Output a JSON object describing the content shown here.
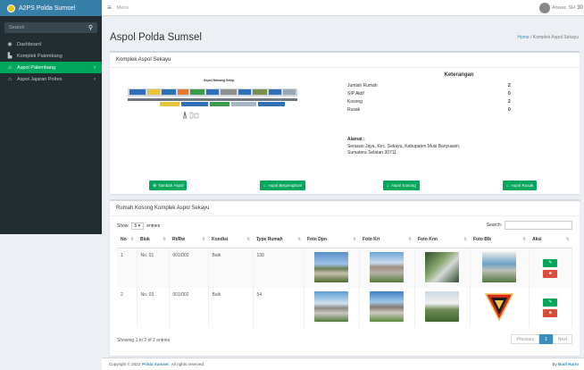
{
  "app": {
    "logo_text": "A2PS Polda Sumsel",
    "brand_color": "#00a65a"
  },
  "sidebar": {
    "search_placeholder": "Search",
    "items": [
      {
        "icon": "dashboard-icon",
        "label": "Dashboard"
      },
      {
        "icon": "building-icon",
        "label": "Komplek Palembang"
      },
      {
        "icon": "home-icon",
        "label": "Aspol Palembang"
      },
      {
        "icon": "home-icon",
        "label": "Aspol Jajaran Polres"
      }
    ]
  },
  "topbar": {
    "menu_label": "Menu",
    "user_name": "Anwar, SH",
    "extra": "30"
  },
  "page": {
    "title": "Aspol Polda Sumsel",
    "breadcrumb_home": "Home",
    "breadcrumb_sep": "/",
    "breadcrumb_current": "Komplek Aspol Sekayu"
  },
  "box1": {
    "title": "Komplek Aspol Sekayu",
    "map_title": "Aspol Mebang Sekip",
    "keterangan": {
      "heading": "Keterangan",
      "rows": [
        {
          "label": "Jumlah Rumah",
          "value": "2"
        },
        {
          "label": "SIP Aktif",
          "value": "0"
        },
        {
          "label": "Kosong",
          "value": "2"
        },
        {
          "label": "Rusak",
          "value": "0"
        }
      ]
    },
    "alamat": {
      "heading": "Alamat :",
      "line1": "Serasan Jaya, Kec. Sekayu, Kabupaten Musi Banyuasin,",
      "line2": "Sumatera Selatan 30711"
    },
    "buttons": {
      "tambah": "Tambah Aspol",
      "berpenghuni": "Aspol Berpenghuni",
      "kosong": "Aspol Kosong",
      "rusak": "Aspol Rusak"
    }
  },
  "box2": {
    "title": "Rumah Kosong Komplek Aspol Sekayu",
    "show": "Show",
    "entries_value": "5",
    "entries": "entries",
    "search_label": "Search:",
    "columns": [
      "No",
      "Blok",
      "Rt/Rw",
      "Kondisi",
      "Type Rumah",
      "Foto Dpn",
      "Foto Kri",
      "Foto Knn",
      "Foto Blk",
      "Aksi"
    ],
    "rows": [
      {
        "no": "1",
        "blok": "No. 01",
        "rtrw": "001/002",
        "kondisi": "Baik",
        "type": "130"
      },
      {
        "no": "2",
        "blok": "No. 03",
        "rtrw": "001/002",
        "kondisi": "Baik",
        "type": "54"
      }
    ],
    "showing": "Showing 1 to 2 of 2 entries",
    "pager": {
      "prev": "Previous",
      "page": "1",
      "next": "Next"
    }
  },
  "footer": {
    "prefix": "Copyright © 2022",
    "brand": "Polda Sumsel.",
    "suffix": "All rights reserved.",
    "by_label": "By",
    "by_name": "Budi Harto"
  }
}
